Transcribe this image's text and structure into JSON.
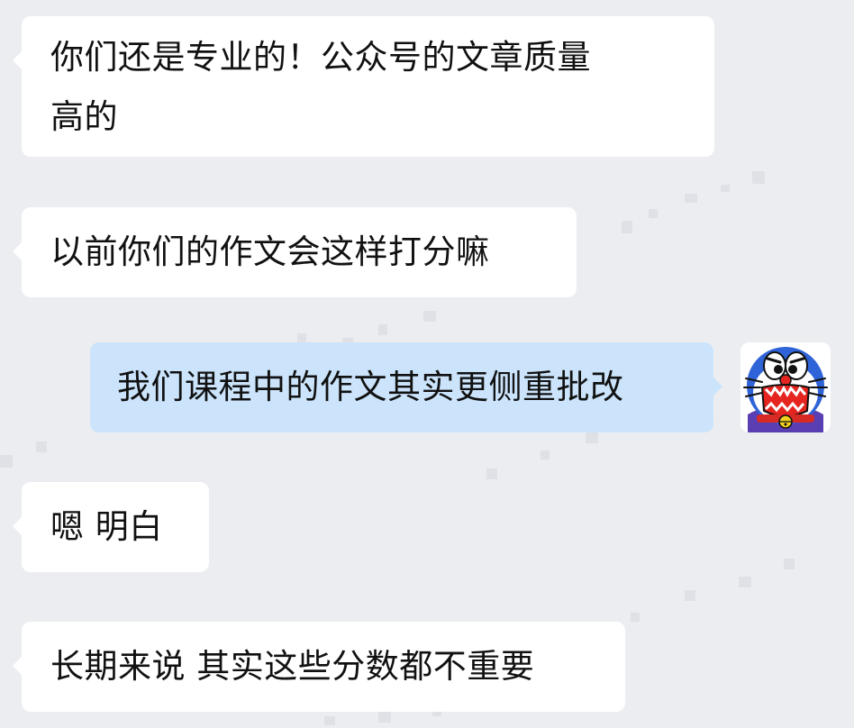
{
  "messages": [
    {
      "side": "left",
      "text": "你们还是专业的！公众号的文章质量\n高的"
    },
    {
      "side": "left",
      "text": "以前你们的作文会这样打分嘛"
    },
    {
      "side": "right",
      "text": "我们课程中的作文其实更侧重批改"
    },
    {
      "side": "left",
      "text": "嗯 明白"
    },
    {
      "side": "left",
      "text": "长期来说 其实这些分数都不重要"
    }
  ],
  "avatar_icon": "doraemon-avatar-icon",
  "colors": {
    "background": "#ebedf1",
    "incoming_bubble": "#ffffff",
    "outgoing_bubble": "#cbe4fb",
    "text": "#111111"
  }
}
